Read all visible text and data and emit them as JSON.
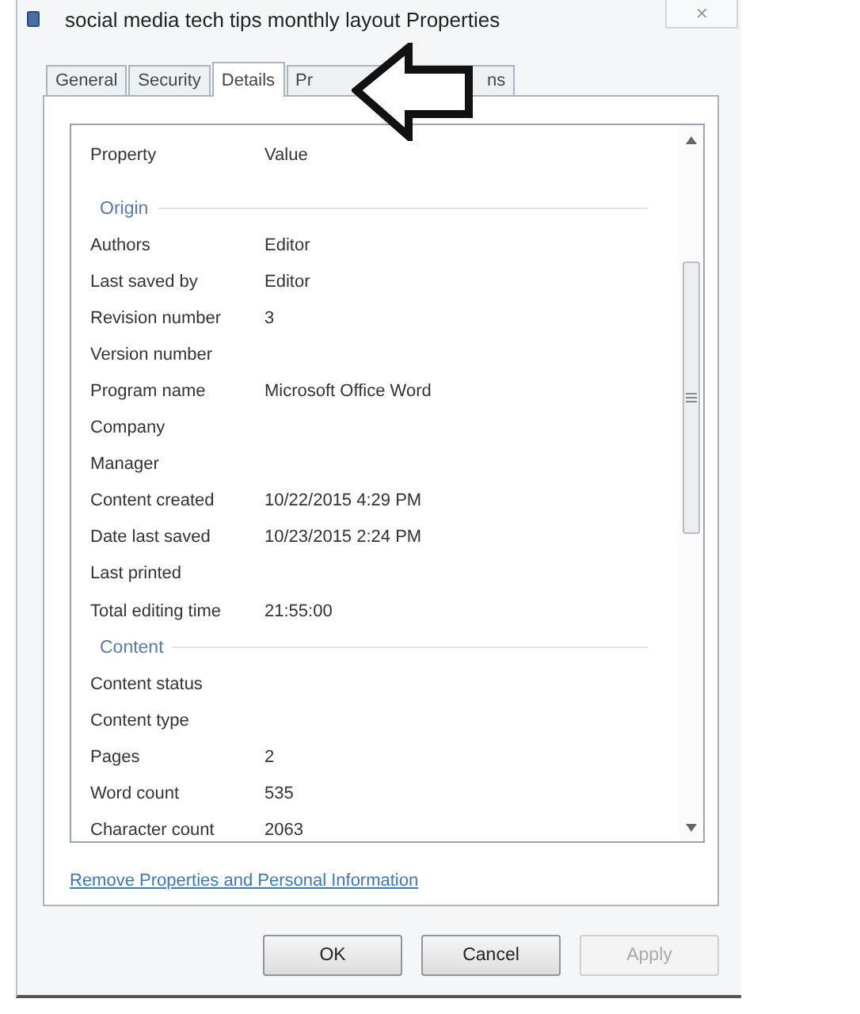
{
  "window": {
    "title": "social media tech tips monthly layout Properties",
    "close": "✕"
  },
  "tabs": [
    {
      "label": "General",
      "selected": false
    },
    {
      "label": "Security",
      "selected": false
    },
    {
      "label": "Details",
      "selected": true
    },
    {
      "label_start": "Pr",
      "label_end": "ns",
      "selected": false
    }
  ],
  "table": {
    "columns": [
      "Property",
      "Value"
    ],
    "rows": [
      {
        "kind": "section",
        "label": "Origin"
      },
      {
        "kind": "property",
        "name": "Authors",
        "value": "Editor"
      },
      {
        "kind": "property",
        "name": "Last saved by",
        "value": "Editor"
      },
      {
        "kind": "property",
        "name": "Revision number",
        "value": "3"
      },
      {
        "kind": "property",
        "name": "Version number"
      },
      {
        "kind": "property",
        "name": "Program name",
        "value": "Microsoft Office Word"
      },
      {
        "kind": "property",
        "name": "Company"
      },
      {
        "kind": "property",
        "name": "Manager"
      },
      {
        "kind": "property",
        "name": "Content created",
        "value": "10/22/2015 4:29 PM"
      },
      {
        "kind": "property",
        "name": "Date last saved",
        "value": "10/23/2015 2:24 PM"
      },
      {
        "kind": "property",
        "name": "Last printed"
      },
      {
        "kind": "property",
        "name": "Total editing time",
        "value": "21:55:00"
      },
      {
        "kind": "section",
        "label": "Content"
      },
      {
        "kind": "property",
        "name": "Content status"
      },
      {
        "kind": "property",
        "name": "Content type"
      },
      {
        "kind": "property",
        "name": "Pages",
        "value": "2"
      },
      {
        "kind": "property",
        "name": "Word count",
        "value": "535"
      },
      {
        "kind": "property",
        "name": "Character count",
        "value": "2063"
      }
    ]
  },
  "link": "Remove Properties and Personal Information",
  "buttons": [
    {
      "label": "OK",
      "disabled": false
    },
    {
      "label": "Cancel",
      "disabled": false
    },
    {
      "label": "Apply",
      "disabled": true
    }
  ]
}
